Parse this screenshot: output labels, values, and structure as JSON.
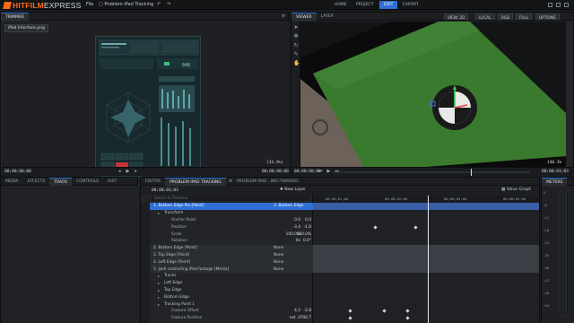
{
  "app": {
    "brand_left": "HITFILM",
    "brand_right": "EXPRESS",
    "menu_file": "File",
    "project_name": "Problem iPad Tracking",
    "undo_icon": "undo-icon",
    "redo_icon": "redo-icon"
  },
  "workspace_tabs": [
    "HOME",
    "PROJECT",
    "EDIT",
    "EXPORT"
  ],
  "trimmer": {
    "tab": "TRIMMER",
    "file_name": "iPad Interface.png",
    "timecode_left": "00;00;00;00",
    "timecode_right": "00;00;00;00",
    "zoom": "(33.3%)"
  },
  "viewer": {
    "tabs": [
      "VIEWER",
      "LAYER"
    ],
    "view_mode": "VIEW: 2D",
    "space": "LOCAL",
    "channel": "RGB",
    "quality": "FULL",
    "options": "OPTIONS",
    "timecode_left": "00;00;00;00",
    "timecode_right": "00;00;03;03",
    "zoom": "140.3%"
  },
  "editor_tabs": [
    "MEDIA",
    "EFFECTS",
    "TRACK",
    "CONTROLS",
    "HIST"
  ],
  "timeline": {
    "tabs": [
      "EDITOR",
      "PROBLEM IPAD TRACKING",
      "PROBLEM IPAD...ING FINISHED"
    ],
    "timecode": "00;00;03;03",
    "new_layer": "New Layer",
    "search_placeholder": "Search in Timeline",
    "value_graph": "Value Graph",
    "ruler_labels": [
      "00;00;01;00",
      "00;00;02;00",
      "00;00;03;00",
      "00;00;04;00"
    ],
    "rows": [
      {
        "label": "1. Bottom Edge Pin [Point]",
        "parent": "3. Bottom Edge",
        "kind": "sel"
      },
      {
        "label": "Transform",
        "kind": "group"
      },
      {
        "label": "Anchor Point",
        "v1": "0.0",
        "v2": "0.0",
        "kind": "prop"
      },
      {
        "label": "Position",
        "v1": "-3.4",
        "v2": "-1.8",
        "kind": "prop"
      },
      {
        "label": "Scale",
        "v1": "100.0%",
        "v2": "100.0%",
        "kind": "prop"
      },
      {
        "label": "Rotation",
        "v1": "0x",
        "v2": "0.0°",
        "kind": "prop"
      },
      {
        "label": "2. Bottom Edge [Point]",
        "parent": "None",
        "kind": "layer"
      },
      {
        "label": "3. Top Edge [Point]",
        "parent": "None",
        "kind": "layer"
      },
      {
        "label": "4. Left Edge [Point]",
        "parent": "None",
        "kind": "layer"
      },
      {
        "label": "5. Josh controlling iPad footage [Media]",
        "parent": "None",
        "kind": "layer"
      },
      {
        "label": "Tracks",
        "kind": "group"
      },
      {
        "label": "Left Edge",
        "kind": "group"
      },
      {
        "label": "Top Edge",
        "kind": "group"
      },
      {
        "label": "Bottom Edge",
        "kind": "group"
      },
      {
        "label": "Tracking Point 1",
        "kind": "group"
      },
      {
        "label": "Feature Offset",
        "v1": "4.2",
        "v2": "-2.8",
        "kind": "prop"
      },
      {
        "label": "Feature Position",
        "v1": "est. 4",
        "v2": "700.7",
        "kind": "prop"
      }
    ]
  },
  "meters": {
    "title": "METERS",
    "ticks": [
      "0",
      "-6",
      "-12",
      "-18",
      "-24",
      "-30",
      "-36",
      "-42",
      "-48",
      "-54"
    ]
  },
  "colors": {
    "accent": "#2f6fd6",
    "brand": "#ff6a1a",
    "green_screen": "#3a7a2e",
    "tracker_red": "#e04848"
  }
}
